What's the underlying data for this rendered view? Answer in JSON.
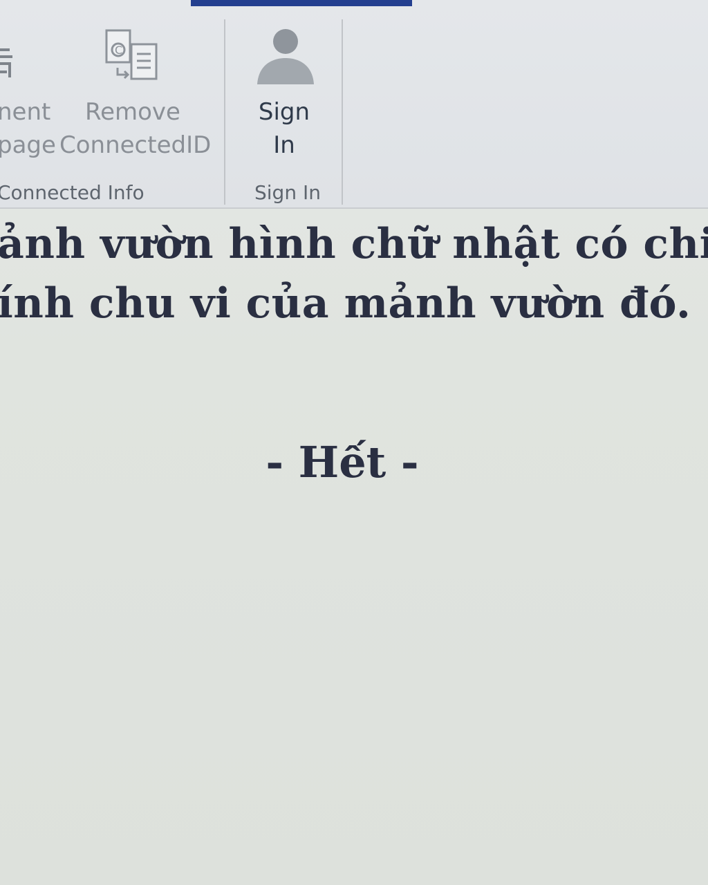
{
  "ribbon": {
    "buttons": [
      {
        "id": "partial-left",
        "lines": [
          "nent",
          "page"
        ]
      },
      {
        "id": "remove-connectedid",
        "lines": [
          "Remove",
          "ConnectedID"
        ]
      },
      {
        "id": "sign-in",
        "lines": [
          "Sign",
          "In"
        ]
      }
    ],
    "groups": [
      {
        "label": "Connected Info"
      },
      {
        "label": "Sign In"
      }
    ],
    "accent_color": "#233f8f"
  },
  "document": {
    "line1": "ảnh vườn hình chữ nhật có chiều",
    "line2": "ính chu vi của mảnh vườn đó.",
    "end_mark": "- Hết -"
  }
}
